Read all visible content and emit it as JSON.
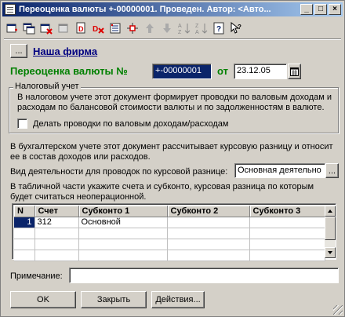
{
  "window": {
    "title": "Переоценка валюты +-00000001. Проведен. Автор: <Авто...",
    "buttons": {
      "minimize": "_",
      "maximize": "□",
      "close": "×"
    }
  },
  "toolbar": {
    "icons": [
      "new-icon",
      "copy-icon",
      "delete-icon",
      "group-icon",
      "post-icon",
      "unpost-icon",
      "movements-icon",
      "structure-icon",
      "arrow-up-icon",
      "arrow-down-icon",
      "sort-asc-icon",
      "sort-desc-icon",
      "help-icon",
      "whats-this-icon"
    ]
  },
  "firm": {
    "button_label": "...",
    "name": "Наша фирма"
  },
  "document": {
    "title_label": "Переоценка валюты №",
    "number": "+-00000001",
    "date_prefix": "от",
    "date": "23.12.05"
  },
  "tax": {
    "group_title": "Налоговый учет",
    "description_line1": "В налоговом учете этот документ формирует проводки по валовым доходам и",
    "description_line2": "расходам по балансовой стоимости валюты и по задолженностям в валюте.",
    "checkbox_label": "Делать проводки по валовым  доходам/расходам",
    "checkbox_checked": false
  },
  "accounting": {
    "line1": "В бухгалтерском учете этот документ рассчитывает курсовую разницу и относит",
    "line2": "ее в состав доходов или расходов."
  },
  "activity": {
    "label": "Вид деятельности для проводок по курсовой разнице:",
    "value": "Основная деятельно",
    "button_label": "..."
  },
  "table_note": {
    "line1": "В табличной части укажите счета и субконто, курсовая разница по которым",
    "line2": "будет считаться неоперационной."
  },
  "table": {
    "columns": [
      "N",
      "Счет",
      "Субконто 1",
      "Субконто 2",
      "Субконто 3"
    ],
    "rows": [
      [
        "1",
        "312",
        "Основной",
        "",
        ""
      ],
      [
        "",
        "",
        "",
        "",
        ""
      ],
      [
        "",
        "",
        "",
        "",
        ""
      ],
      [
        "",
        "",
        "",
        "",
        ""
      ]
    ]
  },
  "note": {
    "label": "Примечание:",
    "value": ""
  },
  "footer": {
    "ok": "OK",
    "close": "Закрыть",
    "actions": "Действия..."
  }
}
